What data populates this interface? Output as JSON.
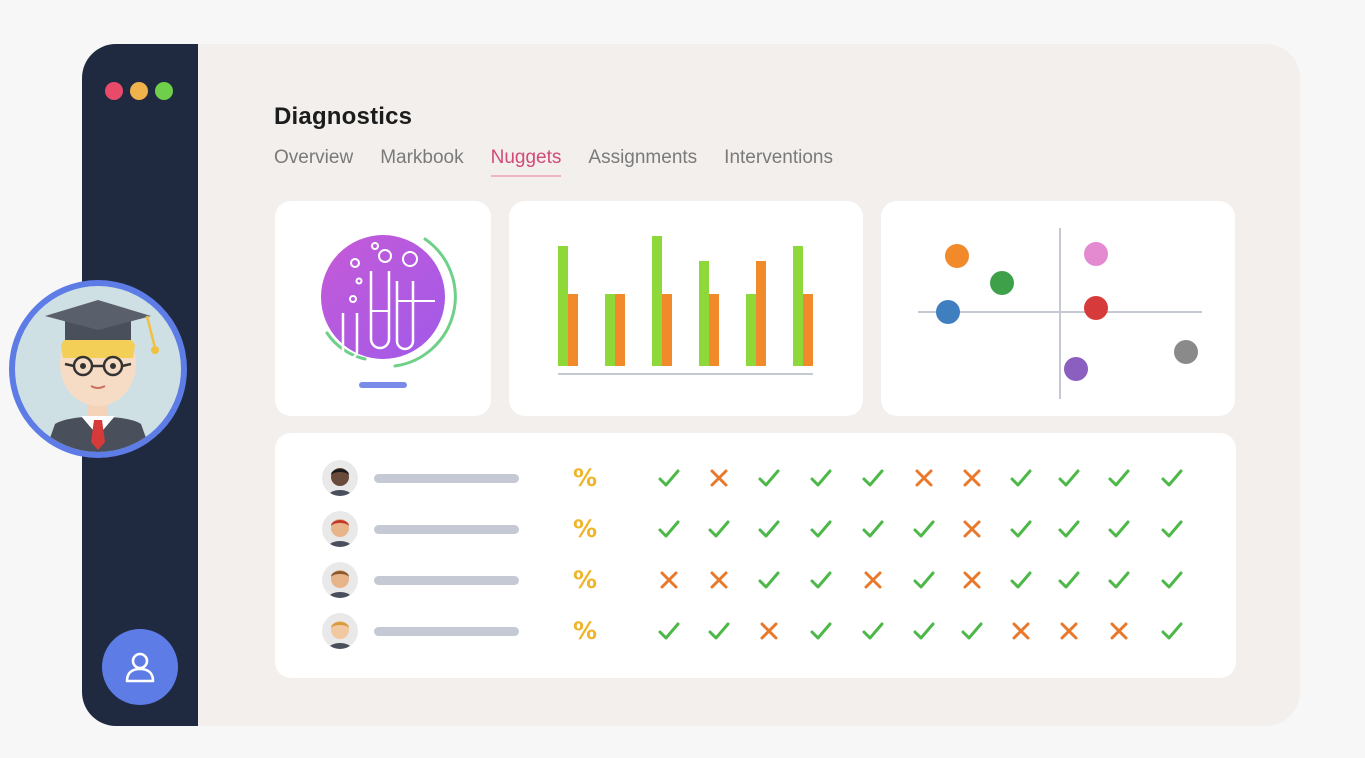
{
  "window_dots": [
    {
      "name": "close-dot",
      "color": "#e84a6a"
    },
    {
      "name": "minimize-dot",
      "color": "#f0b24a"
    },
    {
      "name": "maximize-dot",
      "color": "#6fcf4a"
    }
  ],
  "header": {
    "title": "Diagnostics"
  },
  "tabs": [
    {
      "label": "Overview",
      "active": false
    },
    {
      "label": "Markbook",
      "active": false
    },
    {
      "label": "Nuggets",
      "active": true
    },
    {
      "label": "Assignments",
      "active": false
    },
    {
      "label": "Interventions",
      "active": false
    }
  ],
  "bar_chart": {
    "type": "bar",
    "series": [
      {
        "color": "#8ed83a",
        "values": [
          120,
          72,
          130,
          105,
          72,
          120
        ]
      },
      {
        "color": "#f08a2a",
        "values": [
          72,
          72,
          72,
          72,
          105,
          72
        ]
      }
    ]
  },
  "scatter_chart": {
    "type": "scatter",
    "points": [
      {
        "color": "#f08a2a"
      },
      {
        "color": "#3fa04a"
      },
      {
        "color": "#3f7fc0"
      },
      {
        "color": "#e48ad0"
      },
      {
        "color": "#d63a3a"
      },
      {
        "color": "#8a5fc0"
      },
      {
        "color": "#8a8a8a"
      }
    ]
  },
  "results": {
    "percent_symbol": "%",
    "rows": [
      {
        "marks": [
          "check",
          "cross",
          "check",
          "check",
          "check",
          "cross",
          "cross",
          "check",
          "check",
          "check",
          "check"
        ],
        "skin": "#6a4a3a",
        "hair": "#1a1a1a"
      },
      {
        "marks": [
          "check",
          "check",
          "check",
          "check",
          "check",
          "check",
          "cross",
          "check",
          "check",
          "check",
          "check"
        ],
        "skin": "#e8b48a",
        "hair": "#c23a2a"
      },
      {
        "marks": [
          "cross",
          "cross",
          "check",
          "check",
          "cross",
          "check",
          "cross",
          "check",
          "check",
          "check",
          "check"
        ],
        "skin": "#e8b48a",
        "hair": "#8a5a2a"
      },
      {
        "marks": [
          "check",
          "check",
          "cross",
          "check",
          "check",
          "check",
          "check",
          "cross",
          "cross",
          "cross",
          "check"
        ],
        "skin": "#f2c8a0",
        "hair": "#d89a3a"
      }
    ]
  },
  "colors": {
    "check": "#4cb848",
    "cross": "#e8792a",
    "accent_tab": "#d14a7a",
    "avatar_ring": "#5d7ce6"
  }
}
